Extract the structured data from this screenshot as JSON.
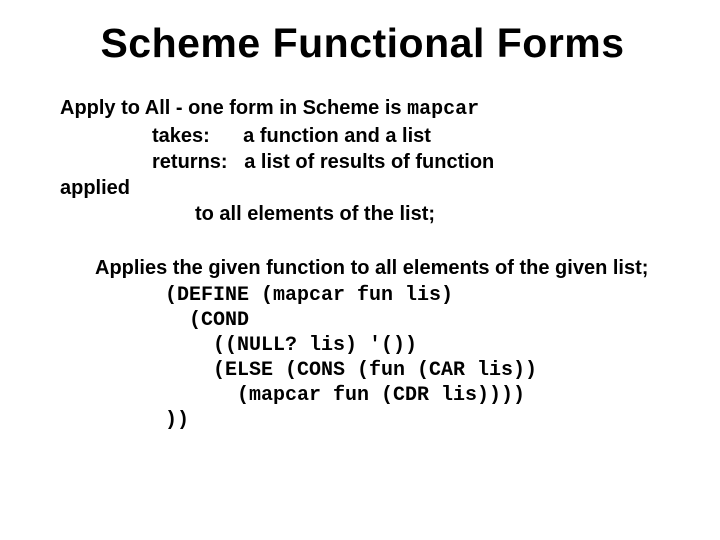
{
  "title": "Scheme Functional Forms",
  "atoa": {
    "prefix": "Apply to All",
    "desc": " - one form in Scheme is ",
    "fn": "mapcar",
    "takes_label": "takes:",
    "takes_val": "a function and a list",
    "returns_label": "returns:",
    "returns_val": "a list of results of function",
    "applied": "applied",
    "tail": "to all elements of the list;"
  },
  "explain": "Applies the given function to all elements of the given list;",
  "code": {
    "l1": "(DEFINE (mapcar fun lis)",
    "l2": "  (COND",
    "l3": "    ((NULL? lis) '())",
    "l4": "    (ELSE (CONS (fun (CAR lis))",
    "l5": "      (mapcar fun (CDR lis))))",
    "l6": "))"
  }
}
